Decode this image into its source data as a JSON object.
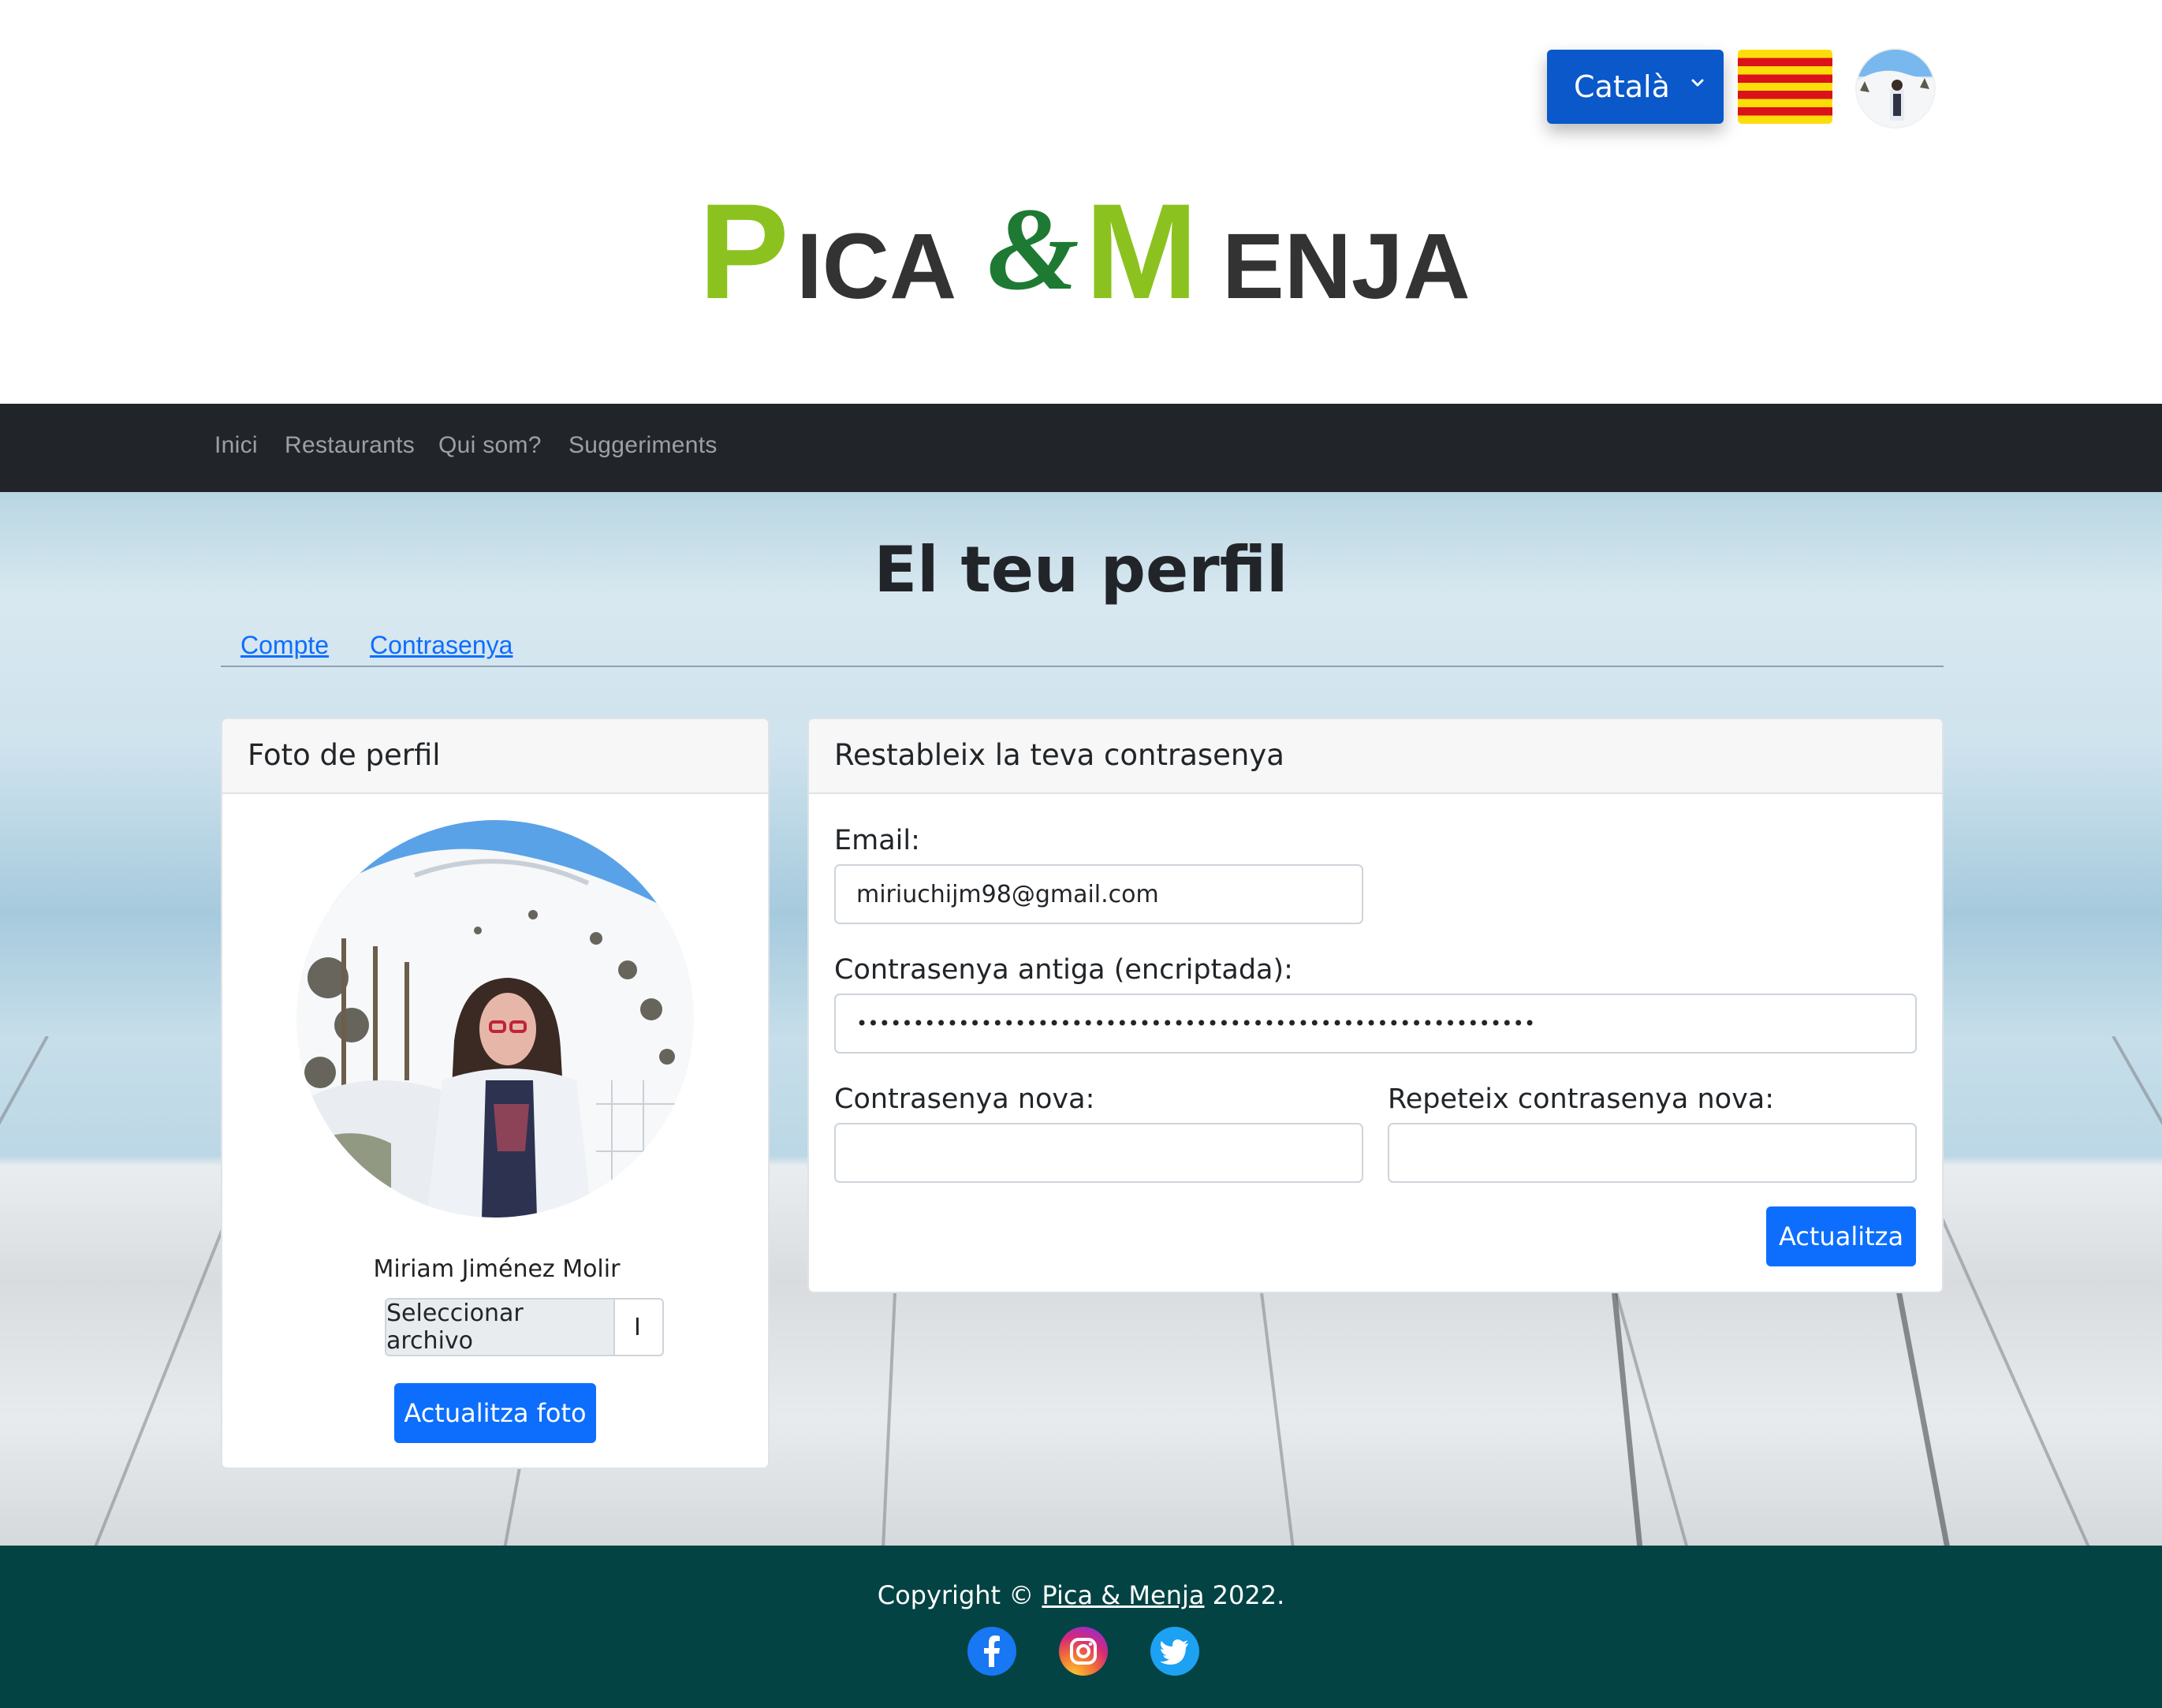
{
  "header": {
    "language_select": {
      "value": "Català"
    },
    "flag_icon": "catalan-flag",
    "logo": {
      "word1_initial": "P",
      "word1_rest": "ICA",
      "ampersand": "&",
      "word2_initial": "M",
      "word2_rest": "ENJA"
    }
  },
  "nav": {
    "items": [
      {
        "label": "Inici"
      },
      {
        "label": "Restaurants"
      },
      {
        "label": "Qui som?"
      },
      {
        "label": "Suggeriments"
      }
    ]
  },
  "page": {
    "title": "El teu perfil",
    "tabs": [
      {
        "label": "Compte"
      },
      {
        "label": "Contrasenya"
      }
    ]
  },
  "photo_card": {
    "header": "Foto de perfil",
    "name": "Miriam Jiménez Molir",
    "file_button": "Seleccionar archivo",
    "file_status": "I",
    "submit": "Actualitza foto"
  },
  "password_card": {
    "header": "Restableix la teva contrasenya",
    "email_label": "Email:",
    "email_value": "miriuchijm98@gmail.com",
    "old_password_label": "Contrasenya antiga (encriptada):",
    "old_password_value": "••••••••••••••••••••••••••••••••••••••••••••••••••••••••••••",
    "new_password_label": "Contrasenya nova:",
    "repeat_password_label": "Repeteix contrasenya nova:",
    "submit": "Actualitza"
  },
  "footer": {
    "copyright_prefix": "Copyright © ",
    "brand_link": "Pica & Menja",
    "copyright_suffix": " 2022.",
    "social": [
      "facebook-icon",
      "instagram-icon",
      "twitter-icon"
    ]
  },
  "colors": {
    "primary": "#0d6efd",
    "nav_bg": "#212529",
    "footer_bg": "#044343",
    "logo_green": "#8cc21f",
    "logo_dark_green": "#1e7a33",
    "logo_gray": "#333333"
  }
}
